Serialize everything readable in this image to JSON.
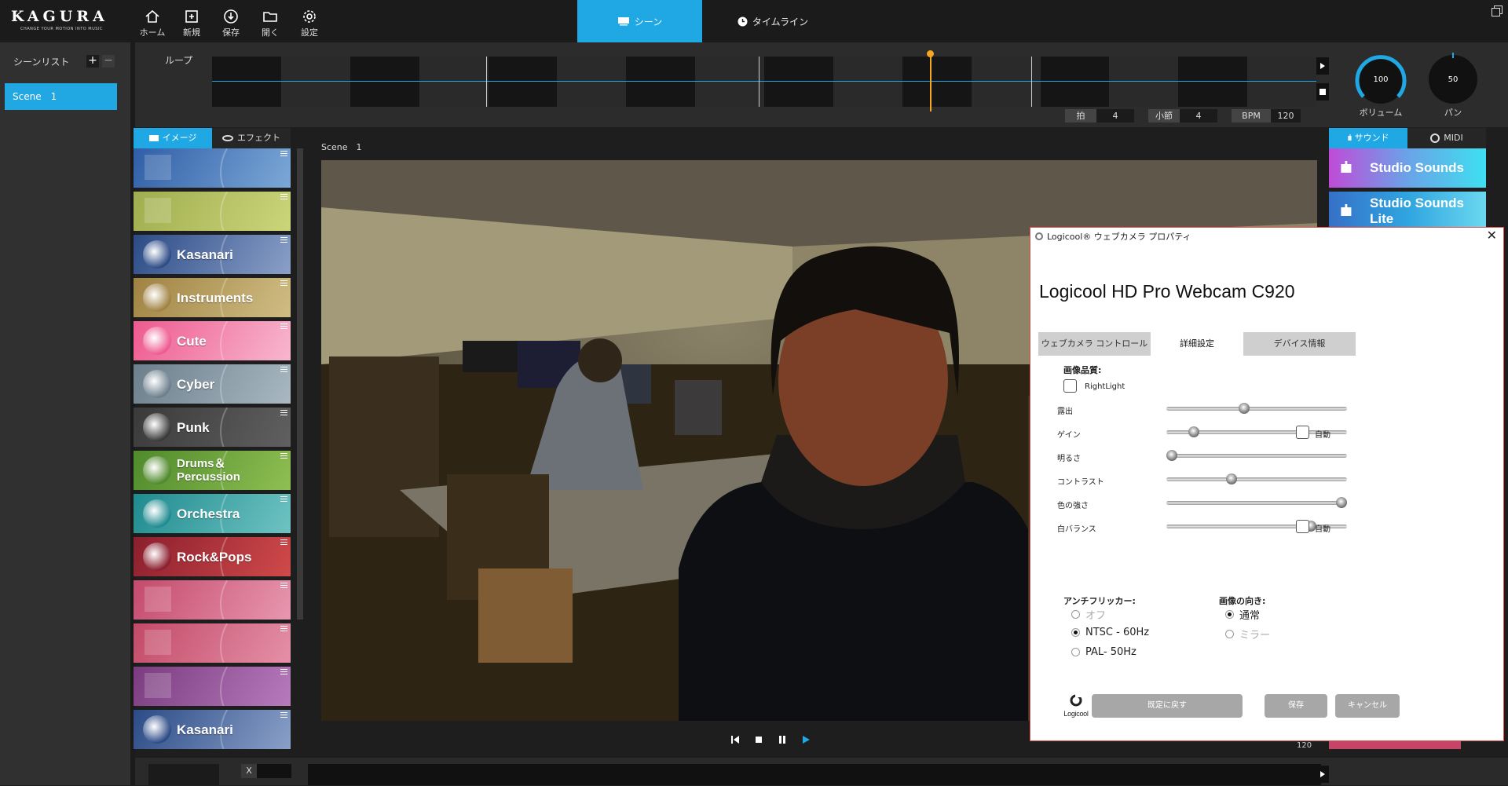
{
  "app": {
    "logo_text": "KAGURA",
    "logo_tagline": "CHANGE YOUR MOTION INTO MUSIC",
    "toolbar": [
      {
        "icon": "home-icon",
        "label": "ホーム"
      },
      {
        "icon": "new-icon",
        "label": "新規"
      },
      {
        "icon": "save-icon",
        "label": "保存"
      },
      {
        "icon": "open-folder-icon",
        "label": "開く"
      },
      {
        "icon": "gear-icon",
        "label": "設定"
      }
    ],
    "tabs": {
      "scene": "シーン",
      "timeline": "タイムライン"
    }
  },
  "sidebar": {
    "title": "シーンリスト",
    "add": "+",
    "remove": "−",
    "scenes": [
      "Scene　1"
    ]
  },
  "loop": {
    "label": "ループ",
    "beat_label": "拍",
    "beat_value": "4",
    "measure_label": "小節",
    "measure_value": "4",
    "bpm_label": "BPM",
    "bpm_value": "120",
    "playhead_position": 0.65
  },
  "knobs": {
    "volume": {
      "value": "100",
      "label": "ボリューム"
    },
    "pan": {
      "value": "50",
      "label": "パン"
    }
  },
  "image_panel": {
    "tabs": {
      "image": "イメージ",
      "effect": "エフェクト"
    },
    "cards": [
      {
        "name": "",
        "colors": [
          "#2f5ea6",
          "#7ca8d8"
        ]
      },
      {
        "name": "",
        "colors": [
          "#a0ae4f",
          "#cbd57a"
        ]
      },
      {
        "name": "Kasanari",
        "colors": [
          "#2c4b86",
          "#8aa0c8"
        ]
      },
      {
        "name": "Instruments",
        "colors": [
          "#a08343",
          "#d0bd84"
        ]
      },
      {
        "name": "Cute",
        "colors": [
          "#ee5a8f",
          "#f8b7cf"
        ]
      },
      {
        "name": "Cyber",
        "colors": [
          "#6c7f8c",
          "#a9b8c2"
        ]
      },
      {
        "name": "Punk",
        "colors": [
          "#3a3a3a",
          "#606060"
        ]
      },
      {
        "name": "Drums＆\nPercussion",
        "colors": [
          "#4f8a2b",
          "#8fbf53"
        ]
      },
      {
        "name": "Orchestra",
        "colors": [
          "#1f8b8f",
          "#6fc3c2"
        ]
      },
      {
        "name": "Rock&Pops",
        "colors": [
          "#8b1f2e",
          "#d04a4a"
        ]
      },
      {
        "name": "",
        "colors": [
          "#c44a6c",
          "#e897b0"
        ]
      },
      {
        "name": "",
        "colors": [
          "#c24a67",
          "#e590a8"
        ]
      },
      {
        "name": "",
        "colors": [
          "#7a3c7e",
          "#b77bbd"
        ]
      },
      {
        "name": "Kasanari",
        "colors": [
          "#2c4b86",
          "#8aa0c8"
        ]
      }
    ]
  },
  "preview": {
    "scene_label": "Scene　1"
  },
  "sound_panel": {
    "tabs": {
      "sound": "サウンド",
      "midi": "MIDI"
    },
    "sounds": [
      "Studio Sounds",
      "Studio Sounds Lite"
    ]
  },
  "bottom_bar": {
    "x_label": "X",
    "bpm_value": "120"
  },
  "dialog": {
    "title": "Logicool® ウェブカメラ プロパティ",
    "close": "✕",
    "product": "Logicool HD Pro Webcam C920",
    "tabs": [
      "ウェブカメラ コントロール",
      "詳細設定",
      "デバイス情報"
    ],
    "active_tab": 1,
    "image_quality_heading": "画像品質:",
    "rightlight_label": "RightLight",
    "sliders": [
      {
        "label": "露出",
        "value": 0.43,
        "auto": false
      },
      {
        "label": "ゲイン",
        "value": 0.15,
        "auto": true
      },
      {
        "label": "明るさ",
        "value": 0.03,
        "auto": false
      },
      {
        "label": "コントラスト",
        "value": 0.36,
        "auto": false
      },
      {
        "label": "色の強さ",
        "value": 0.97,
        "auto": false
      },
      {
        "label": "白バランス",
        "value": 0.8,
        "auto": true
      }
    ],
    "auto_label": "自動",
    "antiflicker_heading": "アンチフリッカー:",
    "antiflicker_options": [
      "オフ",
      "NTSC - 60Hz",
      "PAL- 50Hz"
    ],
    "antiflicker_selected": 1,
    "orientation_heading": "画像の向き:",
    "orientation_options": [
      "通常",
      "ミラー"
    ],
    "orientation_selected": 0,
    "logo_text": "Logicool",
    "buttons": {
      "restore": "既定に戻す",
      "save": "保存",
      "cancel": "キャンセル"
    }
  },
  "colors": {
    "accent": "#1fa8e3",
    "playhead": "#f5a623"
  }
}
